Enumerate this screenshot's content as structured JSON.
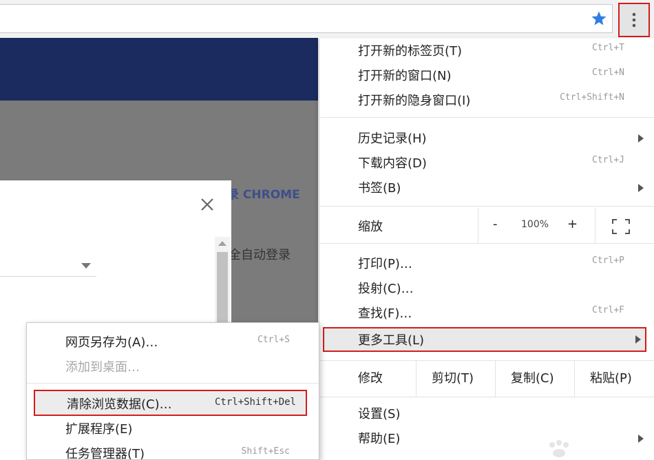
{
  "main_menu": {
    "items": [
      {
        "label": "打开新的标签页(T)",
        "shortcut": "Ctrl+T"
      },
      {
        "label": "打开新的窗口(N)",
        "shortcut": "Ctrl+N"
      },
      {
        "label": "打开新的隐身窗口(I)",
        "shortcut": "Ctrl+Shift+N"
      },
      {
        "label": "历史记录(H)",
        "shortcut": ""
      },
      {
        "label": "下载内容(D)",
        "shortcut": "Ctrl+J"
      },
      {
        "label": "书签(B)",
        "shortcut": ""
      },
      {
        "label": "打印(P)…",
        "shortcut": "Ctrl+P"
      },
      {
        "label": "投射(C)…",
        "shortcut": ""
      },
      {
        "label": "查找(F)…",
        "shortcut": "Ctrl+F"
      },
      {
        "label": "更多工具(L)",
        "shortcut": ""
      },
      {
        "label": "设置(S)",
        "shortcut": ""
      },
      {
        "label": "帮助(E)",
        "shortcut": ""
      }
    ],
    "zoom": {
      "label": "缩放",
      "minus": "-",
      "value": "100%",
      "plus": "+"
    },
    "edit": {
      "label": "修改",
      "cut": "剪切(T)",
      "copy": "复制(C)",
      "paste": "粘贴(P)"
    }
  },
  "sub_menu": {
    "items": [
      {
        "label": "网页另存为(A)…",
        "shortcut": "Ctrl+S"
      },
      {
        "label": "添加到桌面…",
        "shortcut": ""
      },
      {
        "label": "清除浏览数据(C)…",
        "shortcut": "Ctrl+Shift+Del"
      },
      {
        "label": "扩展程序(E)",
        "shortcut": ""
      },
      {
        "label": "任务管理器(T)",
        "shortcut": "Shift+Esc"
      }
    ]
  },
  "background": {
    "text_1": "录 CHROME",
    "text_2": "全自动登录"
  },
  "colors": {
    "highlight_border": "#d41b1b",
    "star": "#2f7de1",
    "banner": "#1b2b60"
  },
  "icons": {
    "star": "bookmark-star-icon",
    "menu": "three-dot-vertical-icon",
    "close": "close-icon",
    "fullscreen": "fullscreen-icon"
  }
}
